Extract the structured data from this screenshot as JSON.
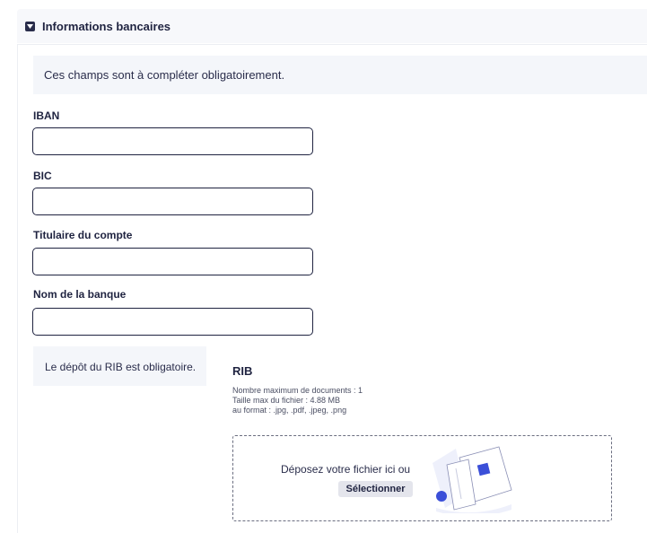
{
  "section": {
    "title": "Informations bancaires"
  },
  "notice": "Ces champs sont à compléter obligatoirement.",
  "fields": [
    {
      "label": "IBAN",
      "value": ""
    },
    {
      "label": "BIC",
      "value": ""
    },
    {
      "label": "Titulaire du compte",
      "value": ""
    },
    {
      "label": "Nom de la banque",
      "value": ""
    }
  ],
  "rib": {
    "notice": "Le dépôt du RIB est obligatoire.",
    "title": "RIB",
    "max_docs": "Nombre maximum de documents : 1",
    "max_size": "Taille max du fichier : 4.88 MB",
    "formats": "au format : .jpg, .pdf, .jpeg, .png",
    "drop_text": "Déposez votre fichier ici ou",
    "select_label": "Sélectionner"
  },
  "icons": {
    "toggle": "caret-down-icon",
    "illustration": "upload-illustration-icon"
  },
  "colors": {
    "text": "#1f2340",
    "panel_bg": "#f7f8fb",
    "accent": "#3b4fd8"
  }
}
